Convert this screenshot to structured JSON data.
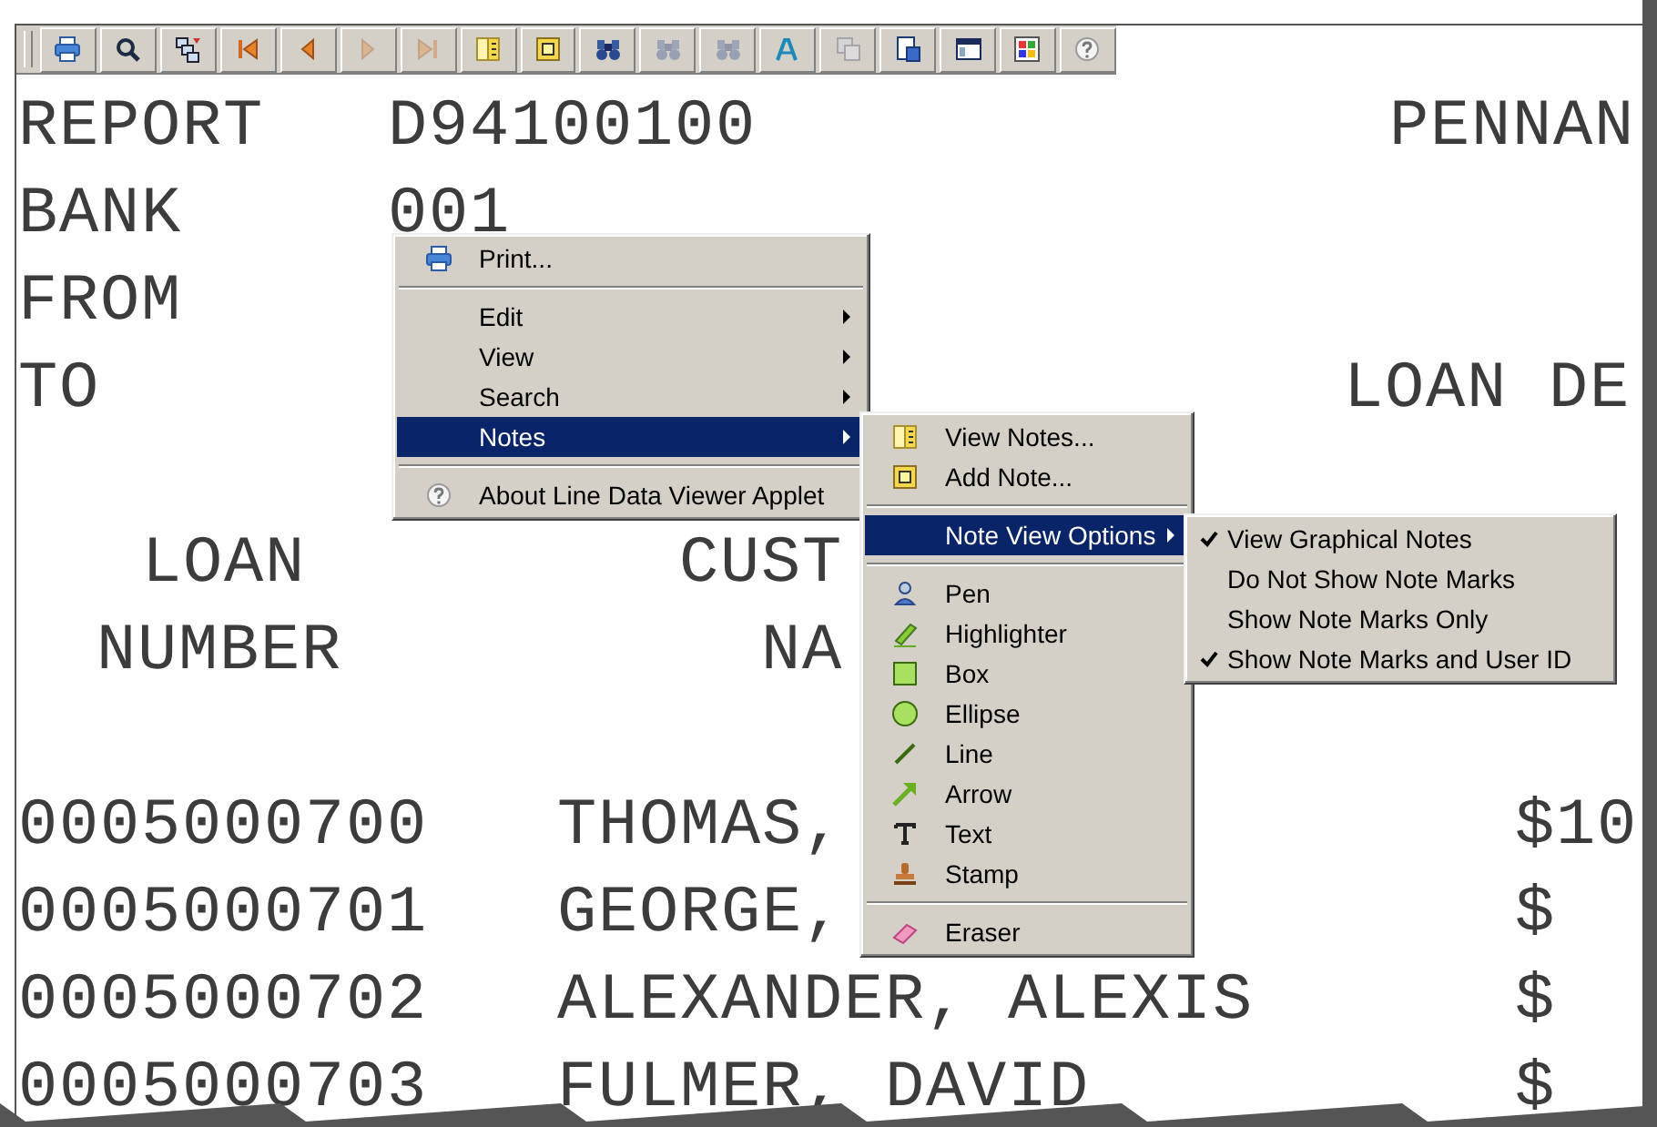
{
  "toolbar": {
    "buttons": [
      {
        "disabled": false
      },
      {
        "disabled": false
      },
      {
        "disabled": false
      },
      {
        "disabled": false
      },
      {
        "disabled": false
      },
      {
        "disabled": true
      },
      {
        "disabled": true
      },
      {
        "disabled": false
      },
      {
        "disabled": false
      },
      {
        "disabled": false
      },
      {
        "disabled": true
      },
      {
        "disabled": true
      },
      {
        "disabled": false
      },
      {
        "disabled": true
      },
      {
        "disabled": false
      },
      {
        "disabled": false
      },
      {
        "disabled": false
      },
      {
        "disabled": false
      }
    ]
  },
  "report": {
    "lines": [
      {
        "segments": [
          "REPORT",
          "D94100100",
          "PENNAN"
        ]
      },
      {
        "segments": [
          "BANK",
          "001"
        ]
      },
      {
        "segments": [
          "FROM"
        ]
      },
      {
        "segments": [
          "TO",
          "LOAN DE"
        ]
      },
      {
        "segments": [
          "LOAN",
          "CUST"
        ]
      },
      {
        "segments": [
          "NUMBER",
          "NA"
        ]
      },
      {
        "segments": [
          "0005000700",
          "THOMAS,",
          "$10"
        ]
      },
      {
        "segments": [
          "0005000701",
          "GEORGE,",
          "$"
        ]
      },
      {
        "segments": [
          "0005000702",
          "ALEXANDER, ALEXIS",
          "$"
        ]
      },
      {
        "segments": [
          "0005000703",
          "FULMER, DAVID",
          "$"
        ]
      }
    ]
  },
  "context_menu": {
    "items": [
      {
        "kind": "item",
        "label": "Print...",
        "submenu": false,
        "selected": false
      },
      {
        "kind": "separator"
      },
      {
        "kind": "item",
        "label": "Edit",
        "submenu": true,
        "selected": false
      },
      {
        "kind": "item",
        "label": "View",
        "submenu": true,
        "selected": false
      },
      {
        "kind": "item",
        "label": "Search",
        "submenu": true,
        "selected": false
      },
      {
        "kind": "item",
        "label": "Notes",
        "submenu": true,
        "selected": true
      },
      {
        "kind": "separator"
      },
      {
        "kind": "item",
        "label": "About Line Data Viewer Applet",
        "submenu": false,
        "selected": false
      }
    ]
  },
  "notes_menu": {
    "items": [
      {
        "kind": "item",
        "label": "View Notes...",
        "submenu": false,
        "selected": false
      },
      {
        "kind": "item",
        "label": "Add Note...",
        "submenu": false,
        "selected": false
      },
      {
        "kind": "separator"
      },
      {
        "kind": "item",
        "label": "Note View Options",
        "submenu": true,
        "selected": true
      },
      {
        "kind": "separator"
      },
      {
        "kind": "item",
        "label": "Pen",
        "submenu": false,
        "selected": false
      },
      {
        "kind": "item",
        "label": "Highlighter",
        "submenu": false,
        "selected": false
      },
      {
        "kind": "item",
        "label": "Box",
        "submenu": false,
        "selected": false
      },
      {
        "kind": "item",
        "label": "Ellipse",
        "submenu": false,
        "selected": false
      },
      {
        "kind": "item",
        "label": "Line",
        "submenu": false,
        "selected": false
      },
      {
        "kind": "item",
        "label": "Arrow",
        "submenu": false,
        "selected": false
      },
      {
        "kind": "item",
        "label": "Text",
        "submenu": false,
        "selected": false
      },
      {
        "kind": "item",
        "label": "Stamp",
        "submenu": false,
        "selected": false
      },
      {
        "kind": "separator"
      },
      {
        "kind": "item",
        "label": "Eraser",
        "submenu": false,
        "selected": false
      }
    ]
  },
  "note_view_options_menu": {
    "items": [
      {
        "label": "View Graphical Notes",
        "checked": true
      },
      {
        "label": "Do Not Show Note Marks",
        "checked": false
      },
      {
        "label": "Show Note Marks Only",
        "checked": false
      },
      {
        "label": "Show Note Marks and User ID",
        "checked": true
      }
    ]
  }
}
